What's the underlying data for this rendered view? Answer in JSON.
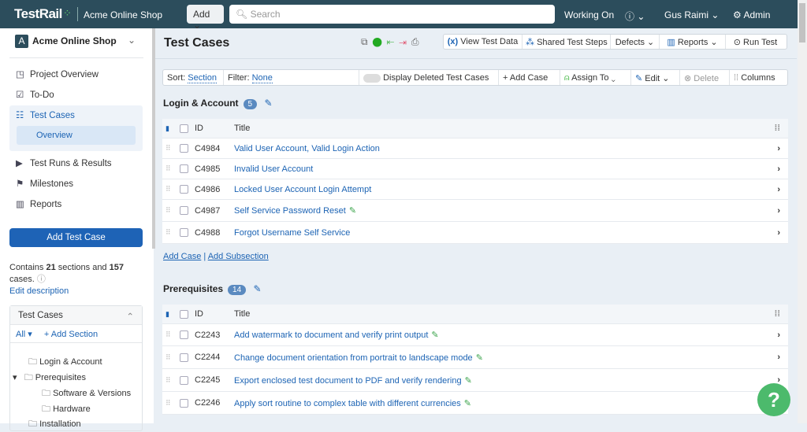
{
  "topbar": {
    "logo": "TestRail",
    "project": "Acme Online Shop",
    "add": "Add",
    "search_placeholder": "Search",
    "working_on": "Working On",
    "user": "Gus Raimi",
    "admin": "Admin"
  },
  "sidebar": {
    "project": "Acme Online Shop",
    "project_initial": "A",
    "nav": [
      "Project Overview",
      "To-Do",
      "Test Cases",
      "Overview",
      "Test Runs & Results",
      "Milestones",
      "Reports"
    ],
    "add_test_case": "Add Test Case",
    "contains_pre": "Contains ",
    "sections": "21",
    "contains_mid": " sections and ",
    "cases": "157",
    "contains_post": " cases.",
    "edit_description": "Edit description",
    "tree_title": "Test Cases",
    "filter_all": "All",
    "add_section": "+ Add Section",
    "tree": [
      "Login & Account",
      "Prerequisites",
      "Software & Versions",
      "Hardware",
      "Installation"
    ]
  },
  "main": {
    "title": "Test Cases",
    "toolbar": [
      "View Test Data",
      "Shared Test Steps",
      "Defects",
      "Reports",
      "Run Test"
    ],
    "filter": {
      "sort_label": "Sort:",
      "sort_value": "Section",
      "filter_label": "Filter:",
      "filter_value": "None",
      "display_deleted": "Display Deleted Test Cases",
      "add_case": "+ Add Case",
      "assign_to": "Assign To",
      "edit": "Edit",
      "delete": "Delete",
      "columns": "Columns"
    },
    "col_id": "ID",
    "col_title": "Title",
    "add_case_link": "Add Case",
    "add_subsection_link": "Add Subsection",
    "sections": [
      {
        "name": "Login & Account",
        "count": "5",
        "rows": [
          {
            "id": "C4984",
            "title": "Valid User Account, Valid Login Action",
            "edit": false
          },
          {
            "id": "C4985",
            "title": "Invalid User Account",
            "edit": false
          },
          {
            "id": "C4986",
            "title": "Locked User Account Login Attempt",
            "edit": false
          },
          {
            "id": "C4987",
            "title": "Self Service Password Reset",
            "edit": true
          },
          {
            "id": "C4988",
            "title": "Forgot Username Self Service",
            "edit": false
          }
        ]
      },
      {
        "name": "Prerequisites",
        "count": "14",
        "rows": [
          {
            "id": "C2243",
            "title": "Add watermark to document and verify print output",
            "edit": true
          },
          {
            "id": "C2244",
            "title": "Change document orientation from portrait to landscape mode",
            "edit": true
          },
          {
            "id": "C2245",
            "title": "Export enclosed test document to PDF and verify rendering",
            "edit": true
          },
          {
            "id": "C2246",
            "title": "Apply sort routine to complex table with different currencies",
            "edit": true
          }
        ]
      }
    ]
  },
  "help": "?"
}
